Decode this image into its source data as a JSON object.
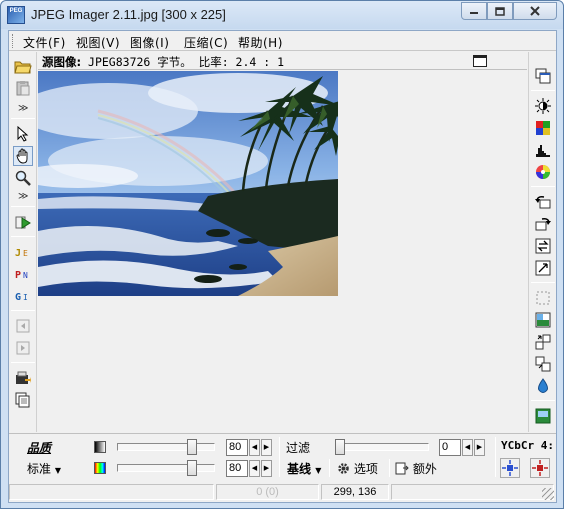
{
  "window": {
    "title": "JPEG Imager 2.11.jpg [300 x 225]",
    "app_icon_text": "PEG"
  },
  "menu": {
    "items": [
      "文件(F)",
      "视图(V)",
      "图像(I)",
      "压缩(C)",
      "帮助(H)"
    ]
  },
  "info_bar": {
    "label": "源图像:",
    "text": " JPEG83726 字节。 比率: 2.4 : 1"
  },
  "left_toolbar": {
    "icons": [
      "open-folder-icon",
      "paste-icon",
      "expand-chevron-icon",
      "select-arrow-icon",
      "hand-pan-icon",
      "zoom-magnifier-icon",
      "expand-chevron-icon",
      "run-compress-icon",
      "jpeg-format-icon",
      "png-format-icon",
      "gif-format-icon",
      "prev-icon",
      "next-icon",
      "export-icon",
      "copy-icon"
    ]
  },
  "right_toolbar": {
    "icons": [
      "new-window-icon",
      "brightness-icon",
      "color-palette-icon",
      "histogram-icon",
      "color-wheel-icon",
      "rotate-left-icon",
      "rotate-right-icon",
      "flip-icon",
      "transform-icon",
      "selection-icon",
      "effects-icon",
      "resize-icon",
      "crop-icon",
      "water-drop-icon",
      "image-icon"
    ]
  },
  "bottom_panel": {
    "quality_label": "品质",
    "quality_value": "80",
    "quality_level": 0.8,
    "mode_label": "标准",
    "color_quality_value": "80",
    "color_quality_level": 0.8,
    "filter_label": "过滤",
    "filter_value": "0",
    "filter_level": 0,
    "baseline_label": "基线",
    "options_label": "选项",
    "extra_label": "额外",
    "ycbcr_label": "YCbCr 4:"
  },
  "status_bar": {
    "cell1": "",
    "cell2": "0 (0)",
    "coords": "299, 136",
    "cell4": ""
  },
  "colors": {
    "frame": "#cfe0f3",
    "client": "#f0f0f0"
  }
}
